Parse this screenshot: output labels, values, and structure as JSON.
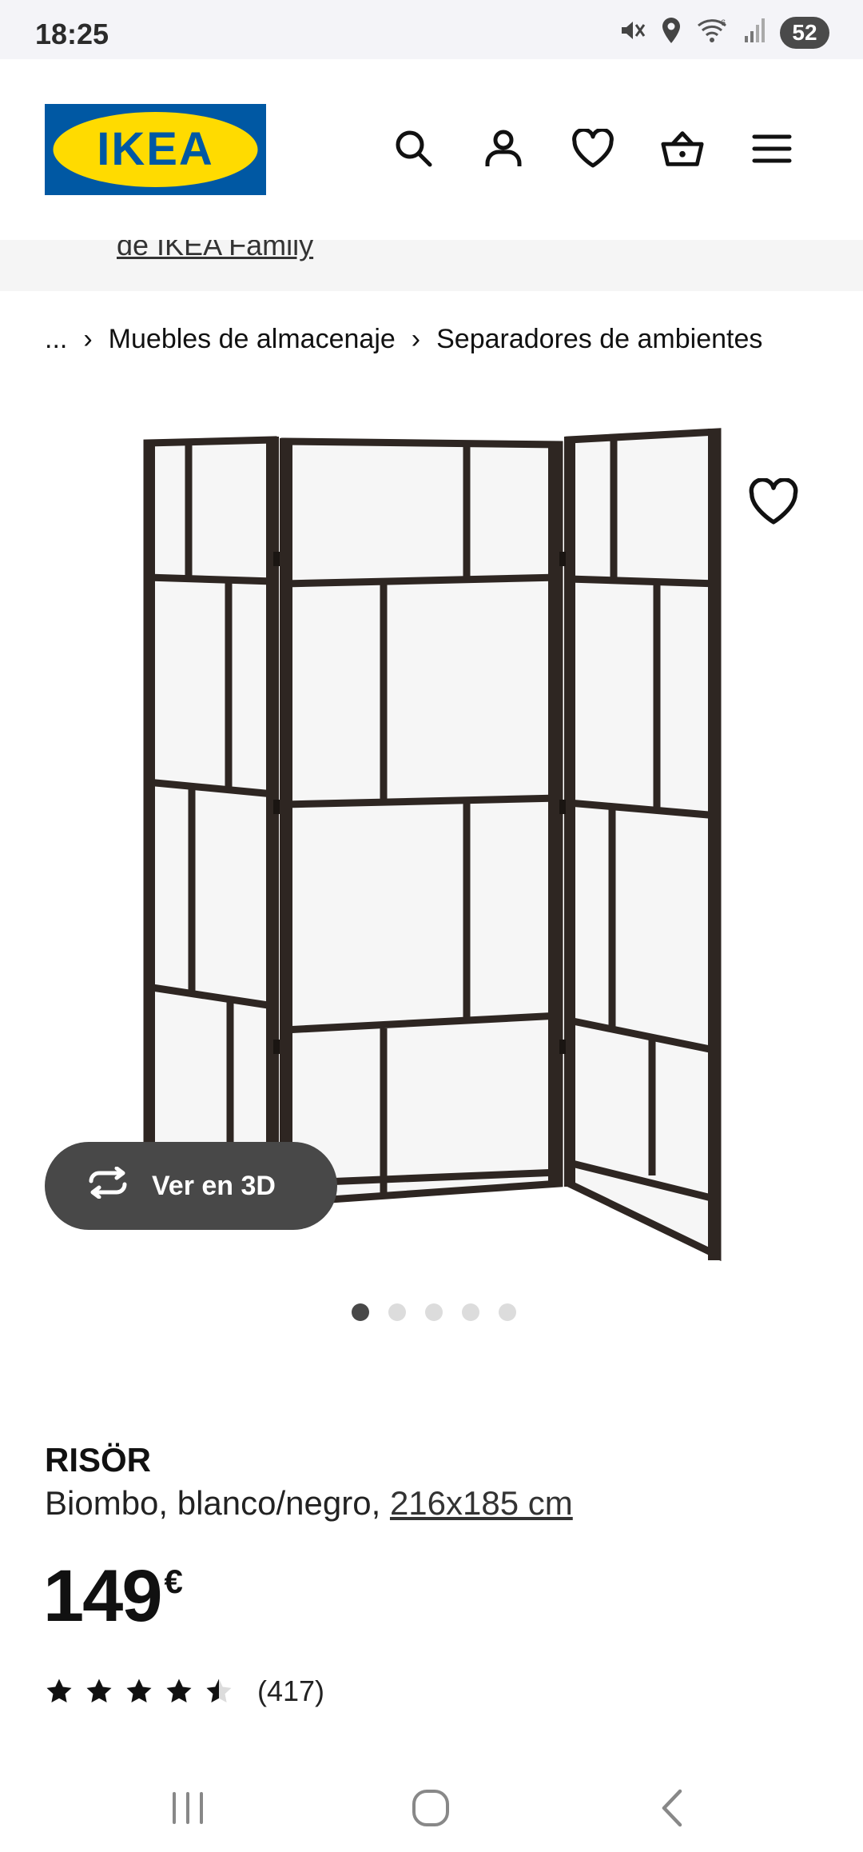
{
  "status_bar": {
    "time": "18:25",
    "battery": "52",
    "icons": [
      "mute-icon",
      "location-icon",
      "wifi-icon",
      "signal-icon"
    ]
  },
  "header": {
    "logo_text": "IKEA",
    "icons": [
      "search-icon",
      "account-icon",
      "heart-icon",
      "basket-icon",
      "menu-icon"
    ],
    "brand_colors": {
      "blue": "#0058a3",
      "yellow": "#ffdb00"
    }
  },
  "promo": {
    "text": "de IKEA Family"
  },
  "breadcrumb": {
    "ellipsis": "...",
    "items": [
      "Muebles de almacenaje",
      "Separadores de ambientes"
    ]
  },
  "gallery": {
    "view_3d_label": "Ver en 3D",
    "dot_count": 5,
    "active_dot": 0
  },
  "product": {
    "name": "RISÖR",
    "description": "Biombo, blanco/negro,",
    "size": "216x185 cm",
    "price": "149",
    "currency": "€",
    "rating": 4.5,
    "rating_max": 5,
    "review_count": "(417)"
  },
  "colors": {
    "frame": "#2e2622",
    "panel": "#f6f6f6",
    "button_dark": "#484848"
  }
}
